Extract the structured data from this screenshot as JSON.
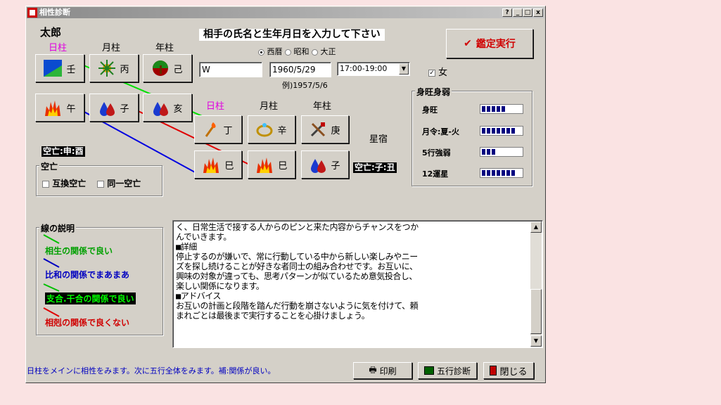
{
  "window": {
    "title": "相性診断",
    "title_buttons": [
      "?",
      "_",
      "□",
      "x"
    ]
  },
  "person": {
    "name": "太郎",
    "headers": [
      "日柱",
      "月柱",
      "年柱"
    ],
    "heaven": [
      {
        "icon": "landscape-icon",
        "label": "壬"
      },
      {
        "icon": "sunburst-icon",
        "label": "丙"
      },
      {
        "icon": "tree-icon",
        "label": "己"
      }
    ],
    "earth": [
      {
        "icon": "fire-icon",
        "label": "午"
      },
      {
        "icon": "water-drop-icon",
        "label": "子"
      },
      {
        "icon": "water-drop-icon",
        "label": "亥"
      }
    ],
    "kubou": "空亡:申:酉"
  },
  "kubou_group": {
    "title": "空亡",
    "options": [
      "互換空亡",
      "同一空亡"
    ]
  },
  "partner_prompt": "相手の氏名と生年月日を入力して下さい",
  "calendar": {
    "options": [
      "西暦",
      "昭和",
      "大正"
    ],
    "selected": 0
  },
  "inputs": {
    "name": "W",
    "birthdate": "1960/5/29",
    "time": "17:00-19:00",
    "example": "例)1957/5/6",
    "female_checked": true,
    "female_label": "女"
  },
  "execute_button": "鑑定実行",
  "partner": {
    "headers": [
      "日柱",
      "月柱",
      "年柱"
    ],
    "heaven": [
      {
        "icon": "match-icon",
        "label": "丁"
      },
      {
        "icon": "ring-icon",
        "label": "辛"
      },
      {
        "icon": "tools-icon",
        "label": "庚"
      }
    ],
    "earth": [
      {
        "icon": "fire-icon",
        "label": "巳"
      },
      {
        "icon": "fire-icon",
        "label": "巳"
      },
      {
        "icon": "water-drop-icon",
        "label": "子"
      }
    ],
    "star_label": "星宿",
    "kubou": "空亡:子:丑"
  },
  "strength": {
    "title": "身旺身弱",
    "rows": [
      {
        "label": "身旺",
        "level": 5
      },
      {
        "label": "月令:夏-火",
        "level": 7
      },
      {
        "label": "5行強弱",
        "level": 3
      },
      {
        "label": "12運星",
        "level": 7
      }
    ],
    "max": 7
  },
  "legend": {
    "title": "線の説明",
    "items": [
      {
        "text": "相生の関係で良い",
        "color": "#00a000",
        "line": "#00c000"
      },
      {
        "text": "比和の関係でまあまあ",
        "color": "#0000c0",
        "line": "#0000c0"
      },
      {
        "text": "支合.干合の関係で良い",
        "color": "#00ff00",
        "line": "#00c000",
        "highlight": true
      },
      {
        "text": "相剋の関係で良くない",
        "color": "#d00000",
        "line": "#e00000"
      }
    ]
  },
  "result_text": "く、日常生活で接する人からのピンと来た内容からチャンスをつか\nんでいきます。\n■詳細\n停止するのが嫌いで、常に行動している中から新しい楽しみやニー\nズを探し続けることが好きな者同士の組み合わせです。お互いに、\n興味の対象が違っても、思考パターンが似ているため意気投合し、\n楽しい関係になります。\n■アドバイス\nお互いの計画と段階を踏んだ行動を崩さないように気を付けて、頼\nまれごとは最後まで実行することを心掛けましょう。",
  "status_text": "日柱をメインに相性をみます。次に五行全体をみます。補:関係が良い。",
  "footer_buttons": {
    "print": "印刷",
    "gogyo": "五行診断",
    "close": "閉じる"
  }
}
